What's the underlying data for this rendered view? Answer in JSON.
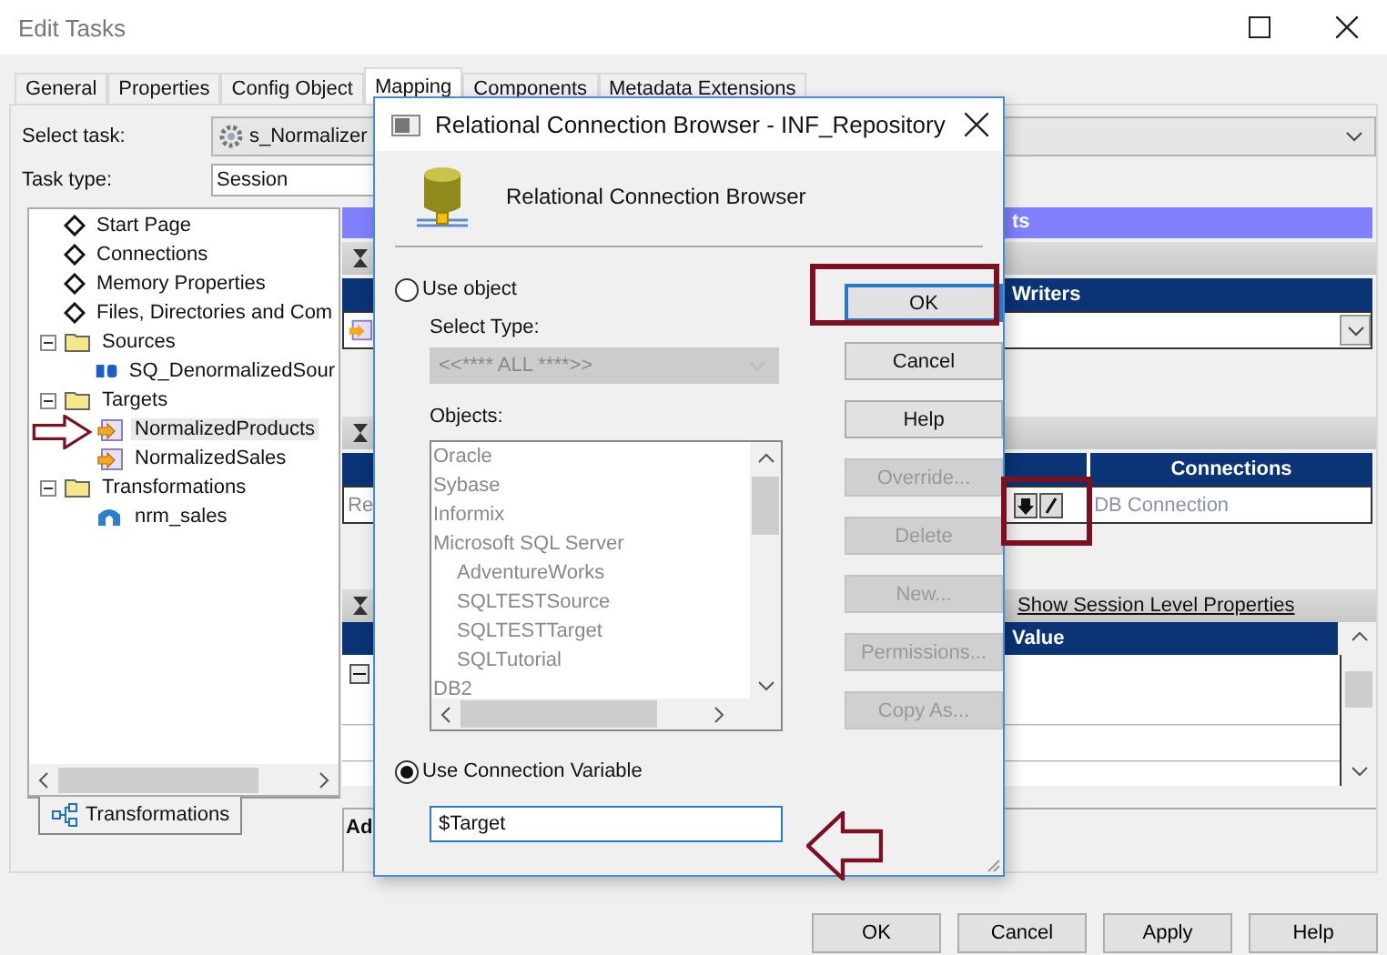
{
  "window": {
    "title": "Edit Tasks"
  },
  "tabs": [
    {
      "label": "General",
      "selected": false
    },
    {
      "label": "Properties",
      "selected": false
    },
    {
      "label": "Config Object",
      "selected": false
    },
    {
      "label": "Mapping",
      "selected": true
    },
    {
      "label": "Components",
      "selected": false
    },
    {
      "label": "Metadata Extensions",
      "selected": false
    }
  ],
  "select_task": {
    "label": "Select task:",
    "value": "s_Normalizer"
  },
  "task_type": {
    "label": "Task type:",
    "value": "Session"
  },
  "tree": [
    {
      "kind": "property",
      "label": "Start Page",
      "selected": false
    },
    {
      "kind": "property",
      "label": "Connections",
      "selected": false
    },
    {
      "kind": "property",
      "label": "Memory Properties",
      "selected": false
    },
    {
      "kind": "property",
      "label": "Files, Directories and Com",
      "selected": false
    },
    {
      "kind": "folder",
      "label": "Sources",
      "expanded": true,
      "selected": false,
      "children": [
        {
          "kind": "source",
          "label": "SQ_DenormalizedSour",
          "selected": false
        }
      ]
    },
    {
      "kind": "folder",
      "label": "Targets",
      "expanded": true,
      "selected": false,
      "children": [
        {
          "kind": "target",
          "label": "NormalizedProducts",
          "selected": true
        },
        {
          "kind": "target",
          "label": "NormalizedSales",
          "selected": false
        }
      ]
    },
    {
      "kind": "folder",
      "label": "Transformations",
      "expanded": true,
      "selected": false,
      "children": [
        {
          "kind": "transformation",
          "label": "nrm_sales",
          "selected": false
        }
      ]
    }
  ],
  "bottom_tab": {
    "label": "Transformations"
  },
  "right_panel": {
    "banner": "ts",
    "writers_header": "Writers",
    "faint_label": "Re",
    "connections_header": "Connections",
    "connection_value": "DB Connection",
    "session_link": "Show Session Level Properties",
    "value_header": "Value",
    "attributes_label": "Ad"
  },
  "dialog": {
    "title": "Relational Connection Browser - INF_Repository",
    "heading": "Relational Connection Browser",
    "use_object": {
      "label": "Use object",
      "selected": false
    },
    "select_type": {
      "label": "Select Type:",
      "value": "<<**** ALL ****>>",
      "disabled": true
    },
    "objects": {
      "label": "Objects:",
      "disabled": true,
      "items": [
        {
          "label": "Oracle"
        },
        {
          "label": "Sybase"
        },
        {
          "label": "Informix"
        },
        {
          "label": "Microsoft SQL Server",
          "children": [
            {
              "label": "AdventureWorks"
            },
            {
              "label": "SQLTESTSource"
            },
            {
              "label": "SQLTESTTarget"
            },
            {
              "label": "SQLTutorial"
            }
          ]
        },
        {
          "label": "DB2"
        }
      ]
    },
    "use_variable": {
      "label": "Use Connection Variable",
      "selected": true
    },
    "variable_value": "$Target",
    "buttons": [
      {
        "label": "OK",
        "disabled": false,
        "focused": true
      },
      {
        "label": "Cancel",
        "disabled": false,
        "focused": false
      },
      {
        "label": "Help",
        "disabled": false,
        "focused": false
      },
      {
        "label": "Override...",
        "disabled": true,
        "focused": false
      },
      {
        "label": "Delete",
        "disabled": true,
        "focused": false
      },
      {
        "label": "New...",
        "disabled": true,
        "focused": false
      },
      {
        "label": "Permissions...",
        "disabled": true,
        "focused": false
      },
      {
        "label": "Copy As...",
        "disabled": true,
        "focused": false
      }
    ]
  },
  "buttons": [
    "OK",
    "Cancel",
    "Apply",
    "Help"
  ]
}
